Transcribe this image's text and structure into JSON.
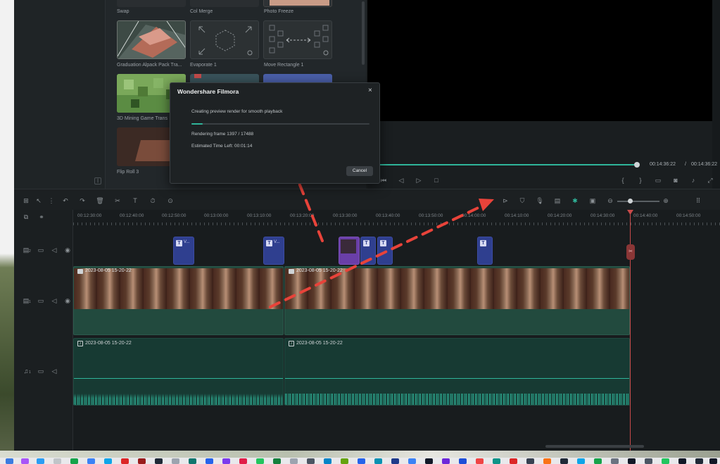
{
  "effects": [
    {
      "label": "Swap"
    },
    {
      "label": "Col Merge"
    },
    {
      "label": "Photo Freeze"
    },
    {
      "label": "Graduation Alpack Pack Tra..."
    },
    {
      "label": "Evaporate 1"
    },
    {
      "label": "Move Rectangle 1"
    },
    {
      "label": "3D Mining Game Trans"
    },
    {
      "label": "Flip Roll 3"
    }
  ],
  "preview": {
    "current_time": "00:14:36:22",
    "separator": "/",
    "total_time": "00:14:36:22"
  },
  "ruler": {
    "labels": [
      "00:12:30:00",
      "00:12:40:00",
      "00:12:50:00",
      "00:13:00:00",
      "00:13:10:00",
      "00:13:20:00",
      "00:13:30:00",
      "00:13:40:00",
      "00:13:50:00",
      "00:14:00:00",
      "00:14:10:00",
      "00:14:20:00",
      "00:14:30:00",
      "00:14:40:00",
      "00:14:50:00"
    ]
  },
  "tracks": {
    "title_clip_label": "V...",
    "video_clip_1": "2023-08-05 15-20-22",
    "video_clip_2": "2023-08-05 15-20-22",
    "audio_clip_1": "2023-08-05 15-20-22",
    "audio_clip_2": "2023-08-05 15-20-22",
    "track_num_1": "1",
    "track_num_2": "2"
  },
  "dialog": {
    "title": "Wondershare Filmora",
    "message": "Creating preview render for smooth playback",
    "progress": 0.062,
    "frame_text": "Rendering frame 1397 / 17488",
    "eta_text": "Estimated Time Left: 00:01:14",
    "cancel_label": "Cancel"
  },
  "colors": {
    "accent": "#2fb59a",
    "arrow": "#e8433a",
    "playhead": "#c84a4a",
    "title_clip": "#2f3f8f"
  }
}
